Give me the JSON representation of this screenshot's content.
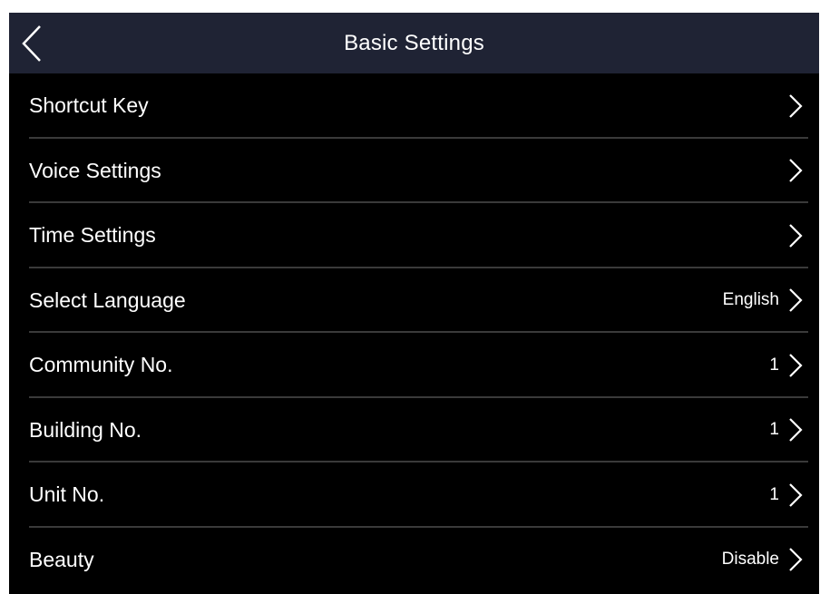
{
  "header": {
    "title": "Basic Settings",
    "back_icon": "chevron-left-icon"
  },
  "settings": [
    {
      "label": "Shortcut Key",
      "value": ""
    },
    {
      "label": "Voice Settings",
      "value": ""
    },
    {
      "label": "Time Settings",
      "value": ""
    },
    {
      "label": "Select Language",
      "value": "English"
    },
    {
      "label": "Community No.",
      "value": "1"
    },
    {
      "label": "Building No.",
      "value": "1"
    },
    {
      "label": "Unit No.",
      "value": "1"
    },
    {
      "label": "Beauty",
      "value": "Disable"
    }
  ],
  "colors": {
    "header_bg": "#1f2334",
    "body_bg": "#000000",
    "divider": "#3a3a3a",
    "text": "#ffffff"
  }
}
